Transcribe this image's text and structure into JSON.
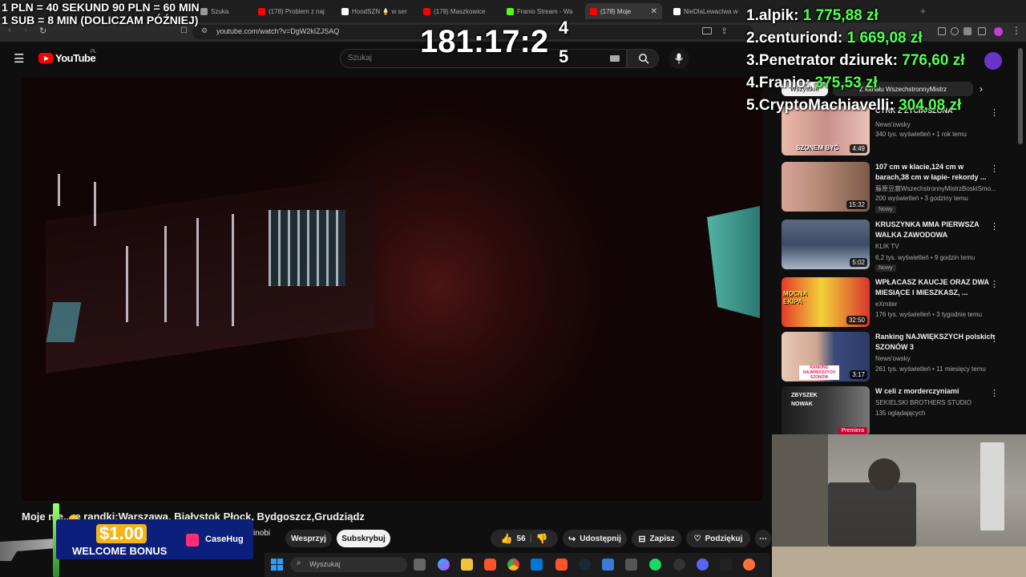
{
  "tabs": [
    {
      "label": "Szuka",
      "color": "#aaaaaa"
    },
    {
      "label": "(178) Problem z naj",
      "color": "#ff0000"
    },
    {
      "label": "HoodSZN 🍦 w ser",
      "color": "#ffffff"
    },
    {
      "label": "(178) Maszkowice",
      "color": "#ff0000"
    },
    {
      "label": "Franio Stream - Wa",
      "color": "#53fc18"
    },
    {
      "label": "(178) Moje",
      "color": "#ff0000"
    },
    {
      "label": "NieDlaLewactwa w",
      "color": "#ffffff"
    }
  ],
  "address": {
    "url": "youtube.com/watch?v=DgW2kIZJSAQ"
  },
  "youtube": {
    "logo_text": "YouTube",
    "region": "PL",
    "search_placeholder": "Szukaj"
  },
  "video": {
    "title": "Moje nie... e randki:Warszawa, Białystok Płock, Bydgoszcz,Grudziądz",
    "channel_fragment": "inobi",
    "support_label": "Wesprzyj",
    "subscribe_label": "Subskrybuj",
    "likes": "56",
    "share_label": "Udostępnij",
    "save_label": "Zapisz",
    "thanks_label": "Podziękuj"
  },
  "sidebar": {
    "filter_chip": "Wszystkie",
    "filter_chip_2": "Z kanału WszechstronnyMistrz",
    "items": [
      {
        "title": "CYRK Z ŻYCIA SZONA",
        "channel": "News'owsky",
        "meta": "340 tys. wyświetleń • 1 rok temu",
        "duration": "4:49",
        "thumb_text": "SZONEM BYĆ",
        "is_new": ""
      },
      {
        "title": "107 cm w klacie,124 cm w barach,38 cm w łapie- rekordy ...",
        "channel": "藤原豆腐WszechstronnyMistrzBoskiSmo...",
        "meta": "200 wyświetleń • 3 godziny temu",
        "duration": "15:32",
        "thumb_text": "",
        "is_new": "Nowy"
      },
      {
        "title": "KRUSZYNKA MMA PIERWSZA WALKA ZAWODOWA",
        "channel": "KLIK TV",
        "meta": "6,2 tys. wyświetleń • 9 godzin temu",
        "duration": "5:02",
        "thumb_text": "",
        "is_new": "Nowy"
      },
      {
        "title": "WPŁACASZ KAUCJE ORAZ DWA MIESIĄCE I MIESZKASZ, ...",
        "channel": "eXmiter",
        "meta": "176 tys. wyświetleń • 3 tygodnie temu",
        "duration": "32:50",
        "thumb_text": "MOCNA EKIPA",
        "is_new": ""
      },
      {
        "title": "Ranking NAJWIĘKSZYCH polskich SZONÓW 3",
        "channel": "News'owsky",
        "meta": "261 tys. wyświetleń • 11 miesięcy temu",
        "duration": "3:17",
        "thumb_text": "RANKING NAJWIĘKSZYCH SZONÓW",
        "is_new": ""
      },
      {
        "title": "W celi z morderczyniami",
        "channel": "SEKIELSKI BROTHERS STUDIO",
        "meta": "135 oglądających",
        "duration": "Premiera",
        "thumb_text": "ZBYSZEK NOWAK",
        "is_new": ""
      }
    ]
  },
  "overlay": {
    "rate_line1": "1 PLN =  40 SEKUND 90 PLN = 60 MIN",
    "rate_line2": "1 SUB = 8 MIN (DOLICZAM PÓŹNIEJ)",
    "timer": "181:17:2",
    "timer_digit_top": "4",
    "timer_digit_bottom": "5",
    "leaderboard": [
      {
        "rank": "1.",
        "name": "alpik:",
        "amount": "1 775,88 zł"
      },
      {
        "rank": "2.",
        "name": "centuriond:",
        "amount": "1 669,08 zł"
      },
      {
        "rank": "3.",
        "name": "Penetrator dziurek:",
        "amount": "776,60 zł"
      },
      {
        "rank": "4.",
        "name": "Franio:",
        "amount": "375,53 zł"
      },
      {
        "rank": "5.",
        "name": "CryptoMachiavelli:",
        "amount": "304,08 zł"
      }
    ]
  },
  "ad": {
    "amount": "$1.00",
    "bonus": "WELCOME BONUS",
    "brand": "CaseHug"
  },
  "taskbar": {
    "search_placeholder": "Wyszukaj"
  },
  "colors": {
    "youtube_red": "#ff0000",
    "leaderboard_amount": "#55ff55",
    "ad_blue": "#0c1f7a",
    "casehug_pink": "#ff2d78"
  }
}
